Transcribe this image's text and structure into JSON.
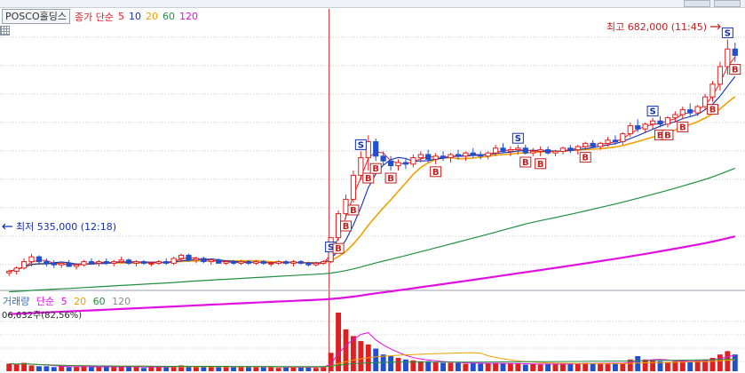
{
  "stock_name": "POSCO홀딩스",
  "legend": {
    "price": {
      "label": "종가 단순",
      "periods": [
        "5",
        "10",
        "20",
        "60",
        "120"
      ]
    },
    "volume": {
      "label": "거래량",
      "ma_label": "단순",
      "periods": [
        "5",
        "20",
        "60",
        "120"
      ]
    }
  },
  "colors": {
    "ma5": "#e0202a",
    "ma10": "#1030b0",
    "ma20": "#f0a000",
    "ma60": "#209040",
    "ma120": "#e010e0",
    "up": "#e02020",
    "down": "#2050d0",
    "vline": "#c03030"
  },
  "annotations": {
    "high": "최고 682,000 (11:45)",
    "low": "최저 535,000 (12:18)",
    "volume_readout": "06,632주(82,56%)"
  },
  "chart_data": {
    "type": "candlestick",
    "x_axis": "intraday minutes",
    "price_range": [
      530000,
      690000
    ],
    "high": 682000,
    "low": 535000,
    "candles": [
      [
        536000,
        538000,
        534000,
        537000
      ],
      [
        537000,
        540000,
        535000,
        539000
      ],
      [
        539000,
        545000,
        538000,
        543000
      ],
      [
        543000,
        548000,
        540000,
        546000
      ],
      [
        546000,
        547000,
        541000,
        543000
      ],
      [
        543000,
        545000,
        540000,
        542000
      ],
      [
        542000,
        544000,
        539000,
        541000
      ],
      [
        541000,
        543000,
        539000,
        542000
      ],
      [
        542000,
        544000,
        540000,
        540000
      ],
      [
        540000,
        542000,
        538000,
        541000
      ],
      [
        541000,
        544000,
        540000,
        543000
      ],
      [
        543000,
        545000,
        541000,
        542000
      ],
      [
        542000,
        544000,
        540000,
        543000
      ],
      [
        543000,
        545000,
        541000,
        542000
      ],
      [
        542000,
        544000,
        540000,
        543000
      ],
      [
        543000,
        546000,
        542000,
        544000
      ],
      [
        544000,
        545000,
        541000,
        542000
      ],
      [
        542000,
        544000,
        540000,
        543000
      ],
      [
        543000,
        544000,
        541000,
        542000
      ],
      [
        542000,
        543000,
        540000,
        542000
      ],
      [
        542000,
        544000,
        541000,
        543000
      ],
      [
        543000,
        545000,
        541000,
        542000
      ],
      [
        542000,
        546000,
        541000,
        545000
      ],
      [
        545000,
        548000,
        543000,
        547000
      ],
      [
        547000,
        548000,
        543000,
        544000
      ],
      [
        544000,
        546000,
        542000,
        545000
      ],
      [
        545000,
        546000,
        542000,
        543000
      ],
      [
        543000,
        545000,
        541000,
        544000
      ],
      [
        544000,
        545000,
        542000,
        542000
      ],
      [
        542000,
        544000,
        541000,
        543000
      ],
      [
        543000,
        544000,
        541000,
        542000
      ],
      [
        542000,
        544000,
        541000,
        543000
      ],
      [
        543000,
        544000,
        541000,
        542000
      ],
      [
        542000,
        544000,
        541000,
        543000
      ],
      [
        543000,
        544000,
        541000,
        542000
      ],
      [
        542000,
        543000,
        540000,
        542000
      ],
      [
        542000,
        544000,
        541000,
        543000
      ],
      [
        543000,
        544000,
        541000,
        542000
      ],
      [
        542000,
        544000,
        540000,
        543000
      ],
      [
        543000,
        544000,
        541000,
        542000
      ],
      [
        542000,
        543000,
        540000,
        541000
      ],
      [
        541000,
        543000,
        540000,
        542000
      ],
      [
        542000,
        544000,
        541000,
        543000
      ],
      [
        543000,
        548000,
        542000,
        558000
      ],
      [
        558000,
        575000,
        556000,
        573000
      ],
      [
        573000,
        585000,
        570000,
        582000
      ],
      [
        582000,
        600000,
        580000,
        597000
      ],
      [
        597000,
        612000,
        594000,
        608000
      ],
      [
        608000,
        622000,
        600000,
        618000
      ],
      [
        618000,
        620000,
        606000,
        609000
      ],
      [
        609000,
        612000,
        603000,
        606000
      ],
      [
        606000,
        609000,
        600000,
        603000
      ],
      [
        603000,
        607000,
        600000,
        605000
      ],
      [
        605000,
        608000,
        601000,
        604000
      ],
      [
        604000,
        610000,
        602000,
        608000
      ],
      [
        608000,
        612000,
        605000,
        610000
      ],
      [
        610000,
        613000,
        605000,
        607000
      ],
      [
        607000,
        611000,
        604000,
        609000
      ],
      [
        609000,
        612000,
        606000,
        608000
      ],
      [
        608000,
        611000,
        605000,
        610000
      ],
      [
        610000,
        613000,
        607000,
        609000
      ],
      [
        609000,
        612000,
        606000,
        611000
      ],
      [
        611000,
        614000,
        608000,
        610000
      ],
      [
        610000,
        612000,
        607000,
        609000
      ],
      [
        609000,
        612000,
        607000,
        611000
      ],
      [
        611000,
        616000,
        609000,
        614000
      ],
      [
        614000,
        617000,
        611000,
        612000
      ],
      [
        612000,
        615000,
        609000,
        613000
      ],
      [
        613000,
        616000,
        610000,
        614000
      ],
      [
        614000,
        616000,
        610000,
        611000
      ],
      [
        611000,
        614000,
        609000,
        612000
      ],
      [
        612000,
        615000,
        609000,
        613000
      ],
      [
        613000,
        615000,
        610000,
        611000
      ],
      [
        611000,
        613000,
        609000,
        612000
      ],
      [
        612000,
        615000,
        610000,
        614000
      ],
      [
        614000,
        616000,
        611000,
        613000
      ],
      [
        613000,
        616000,
        610000,
        615000
      ],
      [
        615000,
        618000,
        613000,
        617000
      ],
      [
        617000,
        619000,
        614000,
        615000
      ],
      [
        615000,
        618000,
        613000,
        617000
      ],
      [
        617000,
        621000,
        615000,
        619000
      ],
      [
        619000,
        622000,
        616000,
        618000
      ],
      [
        618000,
        624000,
        616000,
        623000
      ],
      [
        623000,
        630000,
        621000,
        628000
      ],
      [
        628000,
        632000,
        624000,
        626000
      ],
      [
        626000,
        630000,
        624000,
        629000
      ],
      [
        629000,
        633000,
        626000,
        631000
      ],
      [
        631000,
        634000,
        627000,
        629000
      ],
      [
        629000,
        634000,
        627000,
        633000
      ],
      [
        633000,
        637000,
        630000,
        635000
      ],
      [
        635000,
        640000,
        632000,
        638000
      ],
      [
        638000,
        642000,
        634000,
        636000
      ],
      [
        636000,
        641000,
        634000,
        640000
      ],
      [
        640000,
        648000,
        638000,
        646000
      ],
      [
        646000,
        656000,
        643000,
        654000
      ],
      [
        654000,
        668000,
        650000,
        665000
      ],
      [
        665000,
        682000,
        660000,
        676000
      ],
      [
        676000,
        680000,
        668000,
        672000
      ]
    ],
    "volume": [
      9,
      8,
      10,
      7,
      6,
      6,
      5,
      6,
      5,
      5,
      6,
      5,
      5,
      6,
      5,
      5,
      6,
      5,
      4,
      5,
      5,
      6,
      5,
      7,
      6,
      5,
      5,
      5,
      6,
      5,
      5,
      5,
      6,
      5,
      5,
      5,
      4,
      5,
      5,
      5,
      5,
      4,
      6,
      22,
      70,
      50,
      42,
      36,
      32,
      27,
      20,
      18,
      16,
      14,
      13,
      12,
      12,
      11,
      10,
      10,
      10,
      9,
      10,
      9,
      9,
      10,
      9,
      9,
      9,
      8,
      9,
      8,
      9,
      9,
      9,
      9,
      9,
      10,
      9,
      10,
      10,
      9,
      10,
      14,
      18,
      14,
      13,
      12,
      11,
      12,
      13,
      12,
      13,
      14,
      16,
      20,
      24,
      20
    ],
    "markers": [
      {
        "type": "S",
        "index": 43
      },
      {
        "type": "B",
        "index": 44
      },
      {
        "type": "B",
        "index": 45
      },
      {
        "type": "B",
        "index": 46
      },
      {
        "type": "S",
        "index": 47
      },
      {
        "type": "B",
        "index": 48
      },
      {
        "type": "B",
        "index": 49
      },
      {
        "type": "B",
        "index": 51
      },
      {
        "type": "B",
        "index": 57
      },
      {
        "type": "S",
        "index": 68
      },
      {
        "type": "B",
        "index": 69
      },
      {
        "type": "B",
        "index": 71
      },
      {
        "type": "B",
        "index": 77
      },
      {
        "type": "S",
        "index": 86
      },
      {
        "type": "B",
        "index": 87
      },
      {
        "type": "B",
        "index": 88
      },
      {
        "type": "B",
        "index": 90
      },
      {
        "type": "B",
        "index": 94
      },
      {
        "type": "S",
        "index": 96
      },
      {
        "type": "B",
        "index": 97
      }
    ]
  }
}
